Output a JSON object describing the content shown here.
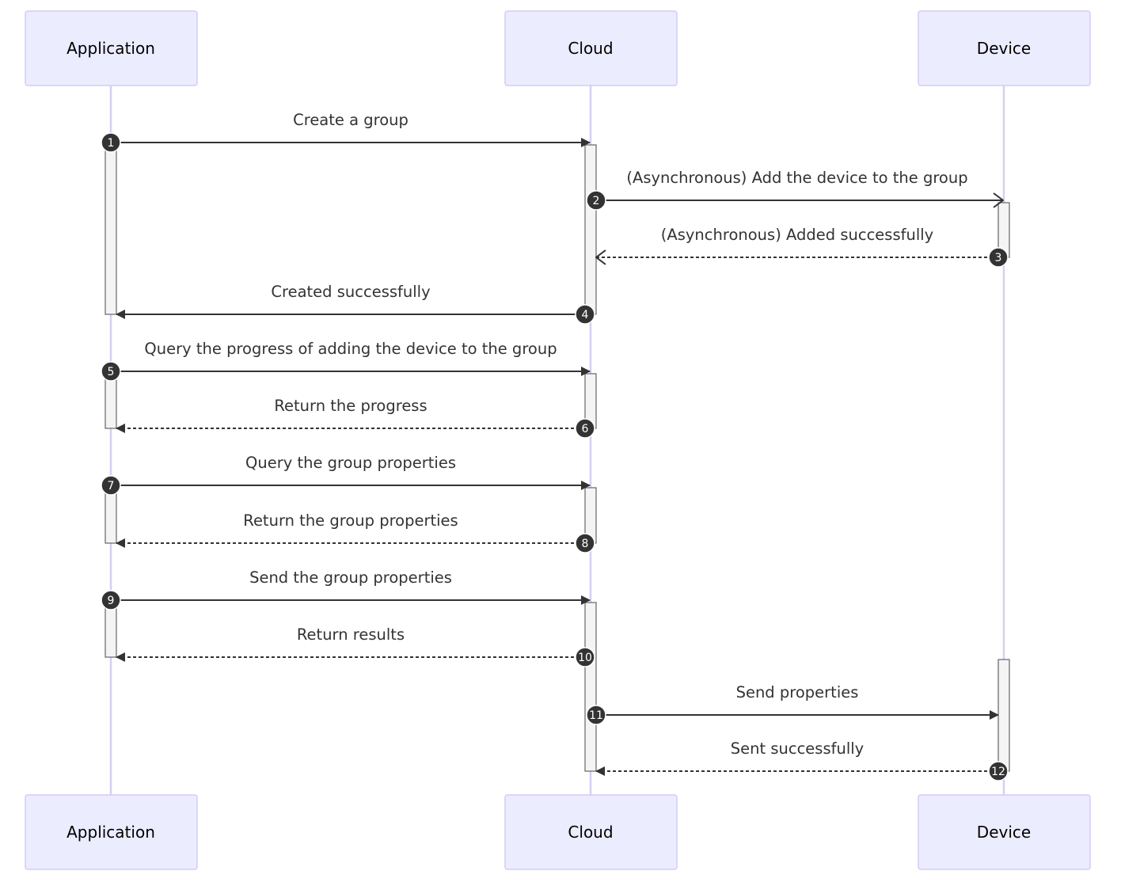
{
  "participants": [
    "Application",
    "Cloud",
    "Device"
  ],
  "messages": [
    {
      "num": "1",
      "from": 0,
      "to": 1,
      "text": "Create a group",
      "style": "solid",
      "arrow": "filled"
    },
    {
      "num": "2",
      "from": 1,
      "to": 2,
      "text": "(Asynchronous) Add the device to the group",
      "style": "solid",
      "arrow": "open"
    },
    {
      "num": "3",
      "from": 2,
      "to": 1,
      "text": "(Asynchronous) Added successfully",
      "style": "dotted",
      "arrow": "open"
    },
    {
      "num": "4",
      "from": 1,
      "to": 0,
      "text": "Created successfully",
      "style": "solid",
      "arrow": "filled"
    },
    {
      "num": "5",
      "from": 0,
      "to": 1,
      "text": "Query the progress of adding the device to the group",
      "style": "solid",
      "arrow": "filled"
    },
    {
      "num": "6",
      "from": 1,
      "to": 0,
      "text": "Return the progress",
      "style": "dotted",
      "arrow": "filled"
    },
    {
      "num": "7",
      "from": 0,
      "to": 1,
      "text": "Query the group properties",
      "style": "solid",
      "arrow": "filled"
    },
    {
      "num": "8",
      "from": 1,
      "to": 0,
      "text": "Return the group properties",
      "style": "dotted",
      "arrow": "filled"
    },
    {
      "num": "9",
      "from": 0,
      "to": 1,
      "text": "Send the group properties",
      "style": "solid",
      "arrow": "filled"
    },
    {
      "num": "10",
      "from": 1,
      "to": 0,
      "text": "Return results",
      "style": "dotted",
      "arrow": "filled"
    },
    {
      "num": "11",
      "from": 1,
      "to": 2,
      "text": "Send properties",
      "style": "solid",
      "arrow": "filled"
    },
    {
      "num": "12",
      "from": 2,
      "to": 1,
      "text": "Sent successfully",
      "style": "dotted",
      "arrow": "filled"
    }
  ],
  "activations": [
    {
      "participant": 0,
      "from": 1,
      "to": 4
    },
    {
      "participant": 1,
      "from": 1,
      "to": 4
    },
    {
      "participant": 2,
      "from": 2,
      "to": 3
    },
    {
      "participant": 0,
      "from": 5,
      "to": 6
    },
    {
      "participant": 1,
      "from": 5,
      "to": 6
    },
    {
      "participant": 0,
      "from": 7,
      "to": 8
    },
    {
      "participant": 1,
      "from": 7,
      "to": 8
    },
    {
      "participant": 0,
      "from": 9,
      "to": 10
    },
    {
      "participant": 1,
      "from": 9,
      "to": 12
    },
    {
      "participant": 2,
      "from": 10,
      "to": 12
    }
  ],
  "colors": {
    "actor_fill": "#ECECFF",
    "actor_stroke": "#D3CCF5",
    "lifeline": "#D6CFF3",
    "line": "#333333",
    "activation_fill": "#F4F4F4"
  }
}
